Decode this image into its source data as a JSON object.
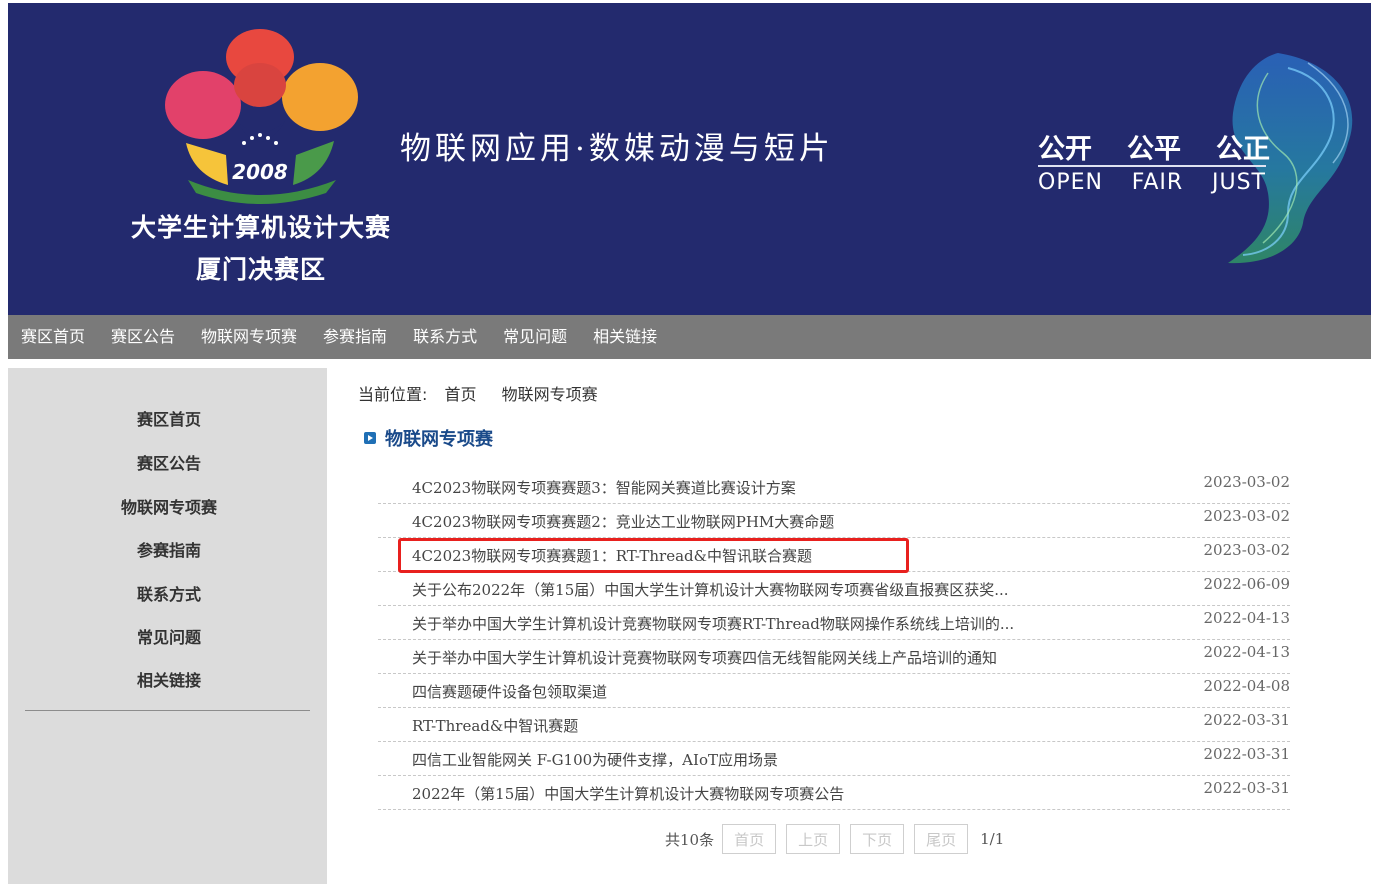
{
  "banner": {
    "logo_year": "2008",
    "logo_line1": "大学生计算机设计大赛",
    "logo_line2": "厦门决赛区",
    "slogan": "物联网应用·数媒动漫与短片",
    "values_cn": [
      "公开",
      "公平",
      "公正"
    ],
    "values_en": [
      "OPEN",
      "FAIR",
      "JUST"
    ]
  },
  "topnav": {
    "items": [
      "赛区首页",
      "赛区公告",
      "物联网专项赛",
      "参赛指南",
      "联系方式",
      "常见问题",
      "相关链接"
    ]
  },
  "sidebar": {
    "items": [
      "赛区首页",
      "赛区公告",
      "物联网专项赛",
      "参赛指南",
      "联系方式",
      "常见问题",
      "相关链接"
    ]
  },
  "breadcrumb": {
    "label": "当前位置:",
    "home": "首页",
    "current": "物联网专项赛"
  },
  "section": {
    "title": "物联网专项赛"
  },
  "news": [
    {
      "title": "4C2023物联网专项赛赛题3：智能网关赛道比赛设计方案",
      "date": "2023-03-02"
    },
    {
      "title": "4C2023物联网专项赛赛题2：竞业达工业物联网PHM大赛命题",
      "date": "2023-03-02"
    },
    {
      "title": "4C2023物联网专项赛赛题1：RT-Thread&中智讯联合赛题",
      "date": "2023-03-02"
    },
    {
      "title": "关于公布2022年（第15届）中国大学生计算机设计大赛物联网专项赛省级直报赛区获奖...",
      "date": "2022-06-09"
    },
    {
      "title": "关于举办中国大学生计算机设计竞赛物联网专项赛RT-Thread物联网操作系统线上培训的...",
      "date": "2022-04-13"
    },
    {
      "title": "关于举办中国大学生计算机设计竞赛物联网专项赛四信无线智能网关线上产品培训的通知",
      "date": "2022-04-13"
    },
    {
      "title": "四信赛题硬件设备包领取渠道",
      "date": "2022-04-08"
    },
    {
      "title": "RT-Thread&中智讯赛题",
      "date": "2022-03-31"
    },
    {
      "title": "四信工业智能网关 F-G100为硬件支撑，AIoT应用场景",
      "date": "2022-03-31"
    },
    {
      "title": "2022年（第15届）中国大学生计算机设计大赛物联网专项赛公告",
      "date": "2022-03-31"
    }
  ],
  "pager": {
    "total": "共10条",
    "first": "首页",
    "prev": "上页",
    "next": "下页",
    "last": "尾页",
    "count": "1/1"
  },
  "colors": {
    "banner_bg": "#232a6e",
    "nav_bg": "#7a7a7a",
    "sidebar_bg": "#dcdcdc",
    "section_title": "#1a4a8a",
    "highlight": "#e8201e"
  }
}
